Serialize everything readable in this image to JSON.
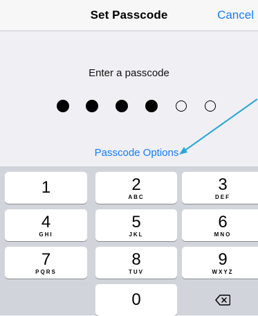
{
  "nav": {
    "title": "Set Passcode",
    "cancel_label": "Cancel"
  },
  "prompt": "Enter a passcode",
  "passcode": {
    "entered": 4,
    "length": 6
  },
  "options_label": "Passcode Options",
  "keypad": {
    "keys": [
      {
        "digit": "1",
        "letters": ""
      },
      {
        "digit": "2",
        "letters": "ABC"
      },
      {
        "digit": "3",
        "letters": "DEF"
      },
      {
        "digit": "4",
        "letters": "GHI"
      },
      {
        "digit": "5",
        "letters": "JKL"
      },
      {
        "digit": "6",
        "letters": "MNO"
      },
      {
        "digit": "7",
        "letters": "PQRS"
      },
      {
        "digit": "8",
        "letters": "TUV"
      },
      {
        "digit": "9",
        "letters": "WXYZ"
      },
      {
        "digit": "0",
        "letters": ""
      }
    ],
    "delete_icon": "backspace-icon"
  },
  "colors": {
    "accent": "#147efb",
    "annotation_arrow": "#2aa6d8",
    "keypad_bg": "#d1d5db"
  }
}
